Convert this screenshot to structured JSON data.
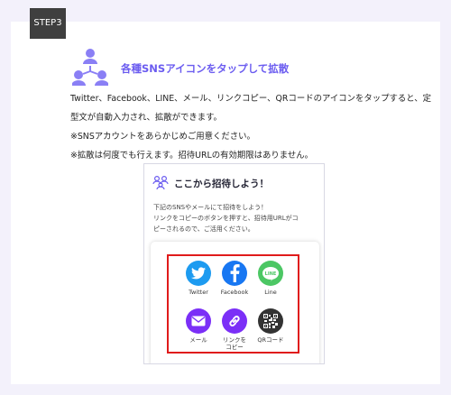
{
  "step": {
    "label": "STEP3"
  },
  "heading": "各種SNSアイコンをタップして拡散",
  "description": [
    "Twitter、Facebook、LINE、メール、リンクコピー、QRコードのアイコンをタップすると、定",
    "型文が自動入力され、拡散ができます。",
    "※SNSアカウントをあらかじめご用意ください。",
    "※拡散は何度でも行えます。招待URLの有効期限はありません。"
  ],
  "phone": {
    "title": "ここから招待しよう！",
    "desc": [
      "下記のSNSやメールにて招待をしよう！",
      "リンクをコピーのボタンを押すと、招待用URLがコ",
      "ピーされるので、ご活用ください。"
    ],
    "sns": [
      {
        "label": "Twitter",
        "icon": "twitter-icon",
        "color": "#1d9bf0"
      },
      {
        "label": "Facebook",
        "icon": "facebook-icon",
        "color": "#1877f2"
      },
      {
        "label": "Line",
        "icon": "line-icon",
        "color": "#4cc764"
      },
      {
        "label": "メール",
        "icon": "mail-icon",
        "color": "#7b2ff7"
      },
      {
        "label": "リンクを\nコピー",
        "icon": "link-icon",
        "color": "#7b2ff7"
      },
      {
        "label": "QRコード",
        "icon": "qr-code-icon",
        "color": "#333333"
      }
    ]
  },
  "colors": {
    "accent": "#6b5cf0",
    "highlight": "#e01b1b",
    "background": "#f3f1fb"
  }
}
